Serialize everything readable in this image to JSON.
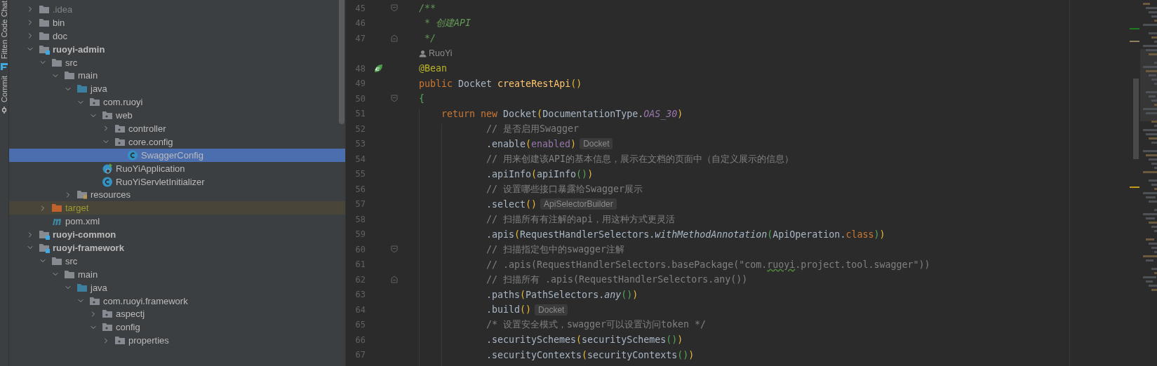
{
  "tool_strip": {
    "tools": [
      {
        "label": "Fitten Code Chat",
        "kind": "fitten"
      },
      {
        "label": "Commit",
        "kind": "commit"
      }
    ]
  },
  "project_tree": {
    "items": [
      {
        "label": ".idea",
        "kind": "ignored-folder",
        "expanded": false,
        "selected": false
      },
      {
        "label": "bin",
        "kind": "folder",
        "expanded": false,
        "selected": false
      },
      {
        "label": "doc",
        "kind": "folder",
        "expanded": false,
        "selected": false
      },
      {
        "label": "ruoyi-admin",
        "kind": "module",
        "expanded": true,
        "selected": false,
        "children": [
          {
            "label": "src",
            "kind": "folder",
            "expanded": true,
            "selected": false,
            "children": [
              {
                "label": "main",
                "kind": "folder",
                "expanded": true,
                "selected": false,
                "children": [
                  {
                    "label": "java",
                    "kind": "source-root",
                    "expanded": true,
                    "selected": false,
                    "children": [
                      {
                        "label": "com.ruoyi",
                        "kind": "package",
                        "expanded": true,
                        "selected": false,
                        "children": [
                          {
                            "label": "web",
                            "kind": "package",
                            "expanded": true,
                            "selected": false,
                            "children": [
                              {
                                "label": "controller",
                                "kind": "package",
                                "expanded": false,
                                "selected": false
                              },
                              {
                                "label": "core.config",
                                "kind": "package",
                                "expanded": true,
                                "selected": false,
                                "children": [
                                  {
                                    "label": "SwaggerConfig",
                                    "kind": "class",
                                    "selected": true
                                  }
                                ]
                              }
                            ]
                          },
                          {
                            "label": "RuoYiApplication",
                            "kind": "boot-class",
                            "selected": false
                          },
                          {
                            "label": "RuoYiServletInitializer",
                            "kind": "class",
                            "selected": false
                          }
                        ]
                      }
                    ]
                  },
                  {
                    "label": "resources",
                    "kind": "resources",
                    "expanded": false,
                    "selected": false
                  }
                ]
              }
            ]
          },
          {
            "label": "target",
            "kind": "excluded",
            "expanded": false,
            "selected": false
          },
          {
            "label": "pom.xml",
            "kind": "maven",
            "selected": false
          }
        ]
      },
      {
        "label": "ruoyi-common",
        "kind": "module",
        "expanded": false,
        "selected": false
      },
      {
        "label": "ruoyi-framework",
        "kind": "module",
        "expanded": true,
        "selected": false,
        "children": [
          {
            "label": "src",
            "kind": "folder",
            "expanded": true,
            "selected": false,
            "children": [
              {
                "label": "main",
                "kind": "folder",
                "expanded": true,
                "selected": false,
                "children": [
                  {
                    "label": "java",
                    "kind": "source-root",
                    "expanded": true,
                    "selected": false,
                    "children": [
                      {
                        "label": "com.ruoyi.framework",
                        "kind": "package",
                        "expanded": true,
                        "selected": false,
                        "children": [
                          {
                            "label": "aspectj",
                            "kind": "package",
                            "expanded": false,
                            "selected": false
                          },
                          {
                            "label": "config",
                            "kind": "package",
                            "expanded": true,
                            "selected": false,
                            "children": [
                              {
                                "label": "properties",
                                "kind": "package",
                                "expanded": false,
                                "selected": false
                              }
                            ]
                          }
                        ]
                      }
                    ]
                  }
                ]
              }
            ]
          }
        ]
      }
    ]
  },
  "editor": {
    "lines": [
      {
        "kind": "code",
        "number": "45",
        "fold_start": true,
        "tokens": [
          {
            "text": "/**",
            "kind": "doc"
          }
        ]
      },
      {
        "kind": "code",
        "number": "46",
        "tokens": [
          {
            "text": " * 创建API",
            "kind": "doc"
          }
        ]
      },
      {
        "kind": "code",
        "number": "47",
        "fold_end": true,
        "tokens": [
          {
            "text": " */",
            "kind": "doc"
          }
        ]
      },
      {
        "kind": "author",
        "text": "RuoYi"
      },
      {
        "kind": "code",
        "number": "48",
        "gutter_icon": true,
        "tokens": [
          {
            "text": "@Bean",
            "kind": "annotation"
          }
        ]
      },
      {
        "kind": "code",
        "number": "49",
        "tokens": [
          {
            "text": "public ",
            "kind": "keyword"
          },
          {
            "text": "Docket ",
            "kind": "plain"
          },
          {
            "text": "createRestApi",
            "kind": "method-decl"
          },
          {
            "text": "()",
            "kind": "bracket1"
          }
        ]
      },
      {
        "kind": "code",
        "number": "50",
        "fold_start": true,
        "tokens": [
          {
            "text": "{",
            "kind": "bracket2"
          }
        ]
      },
      {
        "kind": "code",
        "number": "51",
        "tokens": [
          {
            "text": "    return new ",
            "kind": "keyword"
          },
          {
            "text": "Docket",
            "kind": "plain"
          },
          {
            "text": "(",
            "kind": "bracket1"
          },
          {
            "text": "DocumentationType.",
            "kind": "plain"
          },
          {
            "text": "OAS_30",
            "kind": "static-field"
          },
          {
            "text": ")",
            "kind": "bracket1"
          }
        ]
      },
      {
        "kind": "code",
        "number": "52",
        "tokens": [
          {
            "text": "            // 是否启用Swagger",
            "kind": "comment"
          }
        ]
      },
      {
        "kind": "code",
        "number": "53",
        "hint": "Docket",
        "tokens": [
          {
            "text": "            .enable",
            "kind": "plain"
          },
          {
            "text": "(",
            "kind": "bracket1"
          },
          {
            "text": "enabled",
            "kind": "field"
          },
          {
            "text": ")",
            "kind": "bracket1"
          }
        ]
      },
      {
        "kind": "code",
        "number": "54",
        "tokens": [
          {
            "text": "            // 用来创建该API的基本信息，展示在文档的页面中（自定义展示的信息）",
            "kind": "comment"
          }
        ]
      },
      {
        "kind": "code",
        "number": "55",
        "tokens": [
          {
            "text": "            .apiInfo",
            "kind": "plain"
          },
          {
            "text": "(",
            "kind": "bracket1"
          },
          {
            "text": "apiInfo",
            "kind": "plain"
          },
          {
            "text": "()",
            "kind": "bracket2"
          },
          {
            "text": ")",
            "kind": "bracket1"
          }
        ]
      },
      {
        "kind": "code",
        "number": "56",
        "tokens": [
          {
            "text": "            // 设置哪些接口暴露给Swagger展示",
            "kind": "comment"
          }
        ]
      },
      {
        "kind": "code",
        "number": "57",
        "hint": "ApiSelectorBuilder",
        "tokens": [
          {
            "text": "            .select",
            "kind": "plain"
          },
          {
            "text": "()",
            "kind": "bracket1"
          }
        ]
      },
      {
        "kind": "code",
        "number": "58",
        "tokens": [
          {
            "text": "            // 扫描所有有注解的api，用这种方式更灵活",
            "kind": "comment"
          }
        ]
      },
      {
        "kind": "code",
        "number": "59",
        "tokens": [
          {
            "text": "            .apis",
            "kind": "plain"
          },
          {
            "text": "(",
            "kind": "bracket1"
          },
          {
            "text": "RequestHandlerSelectors.",
            "kind": "plain"
          },
          {
            "text": "withMethodAnnotation",
            "kind": "static-method"
          },
          {
            "text": "(",
            "kind": "bracket2"
          },
          {
            "text": "ApiOperation.",
            "kind": "plain"
          },
          {
            "text": "class",
            "kind": "keyword"
          },
          {
            "text": ")",
            "kind": "bracket2"
          },
          {
            "text": ")",
            "kind": "bracket1"
          }
        ]
      },
      {
        "kind": "code",
        "number": "60",
        "fold_start": true,
        "tokens": [
          {
            "text": "            // 扫描指定包中的swagger注解",
            "kind": "comment"
          }
        ]
      },
      {
        "kind": "code",
        "number": "61",
        "tokens": [
          {
            "text": "            // .apis(RequestHandlerSelectors.basePackage(\"com.",
            "kind": "comment"
          },
          {
            "text": "ruoyi",
            "kind": "comment-typo"
          },
          {
            "text": ".project.tool.swagger\"))",
            "kind": "comment"
          }
        ]
      },
      {
        "kind": "code",
        "number": "62",
        "fold_end": true,
        "tokens": [
          {
            "text": "            // 扫描所有 .apis(RequestHandlerSelectors.any())",
            "kind": "comment"
          }
        ]
      },
      {
        "kind": "code",
        "number": "63",
        "tokens": [
          {
            "text": "            .paths",
            "kind": "plain"
          },
          {
            "text": "(",
            "kind": "bracket1"
          },
          {
            "text": "PathSelectors.",
            "kind": "plain"
          },
          {
            "text": "any",
            "kind": "static-method"
          },
          {
            "text": "()",
            "kind": "bracket2"
          },
          {
            "text": ")",
            "kind": "bracket1"
          }
        ]
      },
      {
        "kind": "code",
        "number": "64",
        "hint": "Docket",
        "tokens": [
          {
            "text": "            .build",
            "kind": "plain"
          },
          {
            "text": "()",
            "kind": "bracket1"
          }
        ]
      },
      {
        "kind": "code",
        "number": "65",
        "tokens": [
          {
            "text": "            /* 设置安全模式，swagger可以设置访问token */",
            "kind": "comment"
          }
        ]
      },
      {
        "kind": "code",
        "number": "66",
        "tokens": [
          {
            "text": "            .securitySchemes",
            "kind": "plain"
          },
          {
            "text": "(",
            "kind": "bracket1"
          },
          {
            "text": "securitySchemes",
            "kind": "plain"
          },
          {
            "text": "()",
            "kind": "bracket2"
          },
          {
            "text": ")",
            "kind": "bracket1"
          }
        ]
      },
      {
        "kind": "code",
        "number": "67",
        "tokens": [
          {
            "text": "            .securityContexts",
            "kind": "plain"
          },
          {
            "text": "(",
            "kind": "bracket1"
          },
          {
            "text": "securityContexts",
            "kind": "plain"
          },
          {
            "text": "()",
            "kind": "bracket2"
          },
          {
            "text": ")",
            "kind": "bracket1"
          }
        ]
      }
    ]
  }
}
